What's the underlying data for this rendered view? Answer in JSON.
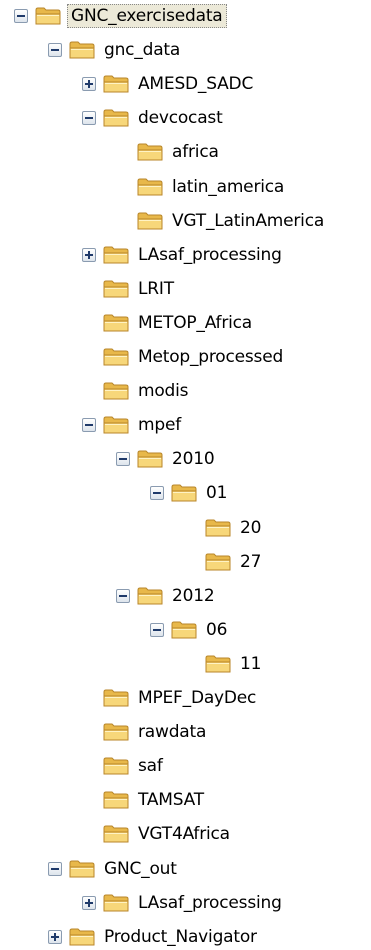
{
  "tree": [
    {
      "label": "GNC_exercisedata",
      "depth": 0,
      "toggle": "minus",
      "selected": true
    },
    {
      "label": "gnc_data",
      "depth": 1,
      "toggle": "minus"
    },
    {
      "label": "AMESD_SADC",
      "depth": 2,
      "toggle": "plus"
    },
    {
      "label": "devcocast",
      "depth": 2,
      "toggle": "minus"
    },
    {
      "label": "africa",
      "depth": 3,
      "toggle": "none"
    },
    {
      "label": "latin_america",
      "depth": 3,
      "toggle": "none"
    },
    {
      "label": "VGT_LatinAmerica",
      "depth": 3,
      "toggle": "none"
    },
    {
      "label": "LAsaf_processing",
      "depth": 2,
      "toggle": "plus"
    },
    {
      "label": "LRIT",
      "depth": 2,
      "toggle": "none"
    },
    {
      "label": "METOP_Africa",
      "depth": 2,
      "toggle": "none"
    },
    {
      "label": "Metop_processed",
      "depth": 2,
      "toggle": "none"
    },
    {
      "label": "modis",
      "depth": 2,
      "toggle": "none"
    },
    {
      "label": "mpef",
      "depth": 2,
      "toggle": "minus"
    },
    {
      "label": "2010",
      "depth": 3,
      "toggle": "minus"
    },
    {
      "label": "01",
      "depth": 4,
      "toggle": "minus"
    },
    {
      "label": "20",
      "depth": 5,
      "toggle": "none"
    },
    {
      "label": "27",
      "depth": 5,
      "toggle": "none"
    },
    {
      "label": "2012",
      "depth": 3,
      "toggle": "minus"
    },
    {
      "label": "06",
      "depth": 4,
      "toggle": "minus"
    },
    {
      "label": "11",
      "depth": 5,
      "toggle": "none"
    },
    {
      "label": "MPEF_DayDec",
      "depth": 2,
      "toggle": "none"
    },
    {
      "label": "rawdata",
      "depth": 2,
      "toggle": "none"
    },
    {
      "label": "saf",
      "depth": 2,
      "toggle": "none"
    },
    {
      "label": "TAMSAT",
      "depth": 2,
      "toggle": "none"
    },
    {
      "label": "VGT4Africa",
      "depth": 2,
      "toggle": "none"
    },
    {
      "label": "GNC_out",
      "depth": 1,
      "toggle": "minus"
    },
    {
      "label": "LAsaf_processing",
      "depth": 2,
      "toggle": "plus"
    },
    {
      "label": "Product_Navigator",
      "depth": 1,
      "toggle": "plus"
    }
  ]
}
